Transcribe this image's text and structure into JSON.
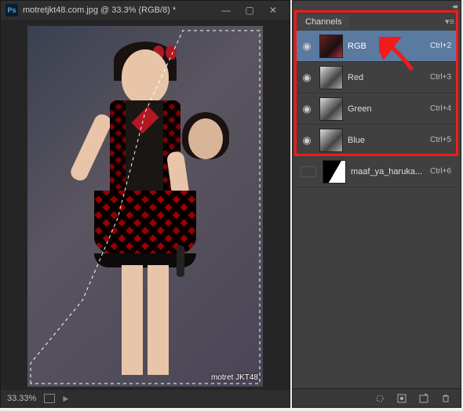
{
  "document": {
    "title": "motretjkt48.com.jpg @ 33.3% (RGB/8) *",
    "zoom_status": "33.33%",
    "watermark": "motret JKT48"
  },
  "window_controls": {
    "minimize": "—",
    "maximize": "▢",
    "close": "✕"
  },
  "panel": {
    "tab_label": "Channels",
    "rows": [
      {
        "name": "RGB",
        "shortcut": "Ctrl+2",
        "visible": true,
        "selected": true,
        "thumb": "rgb"
      },
      {
        "name": "Red",
        "shortcut": "Ctrl+3",
        "visible": true,
        "selected": false,
        "thumb": "gray"
      },
      {
        "name": "Green",
        "shortcut": "Ctrl+4",
        "visible": true,
        "selected": false,
        "thumb": "gray"
      },
      {
        "name": "Blue",
        "shortcut": "Ctrl+5",
        "visible": true,
        "selected": false,
        "thumb": "gray"
      },
      {
        "name": "maaf_ya_haruka...",
        "shortcut": "Ctrl+6",
        "visible": false,
        "selected": false,
        "thumb": "alpha"
      }
    ]
  },
  "icons": {
    "eye": "◉",
    "collapse": "◂◂",
    "panel_menu": "▾≡",
    "chevron": "▶"
  }
}
